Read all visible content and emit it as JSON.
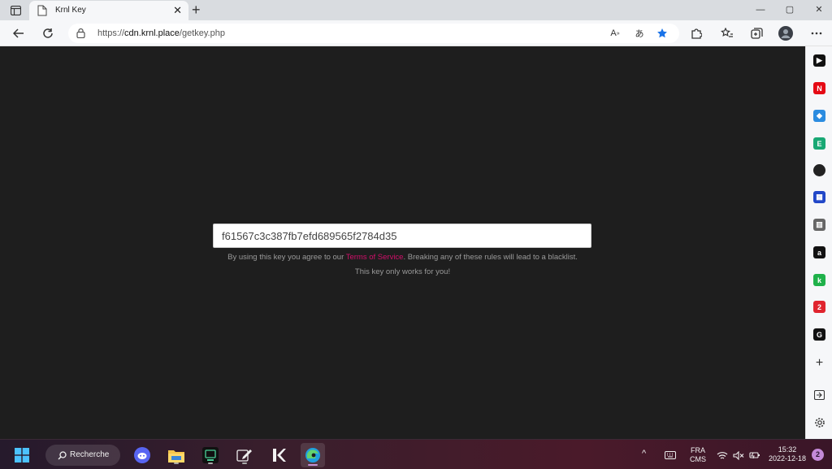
{
  "browser": {
    "tab": {
      "title": "Krnl Key",
      "close_glyph": "✕"
    },
    "new_tab_glyph": "+",
    "window_controls": {
      "minimize": "—",
      "maximize": "▢",
      "close": "✕"
    },
    "address": {
      "scheme": "https://",
      "host": "cdn.krnl.place",
      "path": "/getkey.php"
    },
    "accent_color": "#1a73e8"
  },
  "page": {
    "key_value": "f61567c3c387fb7efd689565f2784d35",
    "agree_prefix": "By using this key you agree to our ",
    "tos_label": "Terms of Service",
    "agree_suffix": ". Breaking any of these rules will lead to a blacklist.",
    "only_for_you": "This key only works for you!",
    "link_color": "#d10f6a"
  },
  "sidebar": {
    "items": [
      {
        "name": "youtube-icon",
        "color": "#111111",
        "glyph": "▶"
      },
      {
        "name": "netflix-icon",
        "color": "#e50914",
        "glyph": "N"
      },
      {
        "name": "app-icon-blue-diamond",
        "color": "#2b8ce0",
        "glyph": "◆"
      },
      {
        "name": "app-icon-green-e",
        "color": "#18a874",
        "glyph": "E"
      },
      {
        "name": "dark-circle-icon",
        "color": "#222222",
        "glyph": ""
      },
      {
        "name": "grid-app-icon",
        "color": "#2147c8",
        "glyph": "▦"
      },
      {
        "name": "calendar-icon",
        "color": "#666666",
        "glyph": "▥"
      },
      {
        "name": "black-app-icon",
        "color": "#111111",
        "glyph": "a"
      },
      {
        "name": "green-k-icon",
        "color": "#1fb14a",
        "glyph": "k"
      },
      {
        "name": "red-2-icon",
        "color": "#e0242e",
        "glyph": "2"
      },
      {
        "name": "grammarly-icon",
        "color": "#111111",
        "glyph": "G"
      }
    ],
    "add_glyph": "+"
  },
  "taskbar": {
    "search_label": "Recherche",
    "language": "FRA",
    "language_sub": "CMS",
    "time": "15:32",
    "date": "2022-12-18",
    "notification_count": "2"
  }
}
